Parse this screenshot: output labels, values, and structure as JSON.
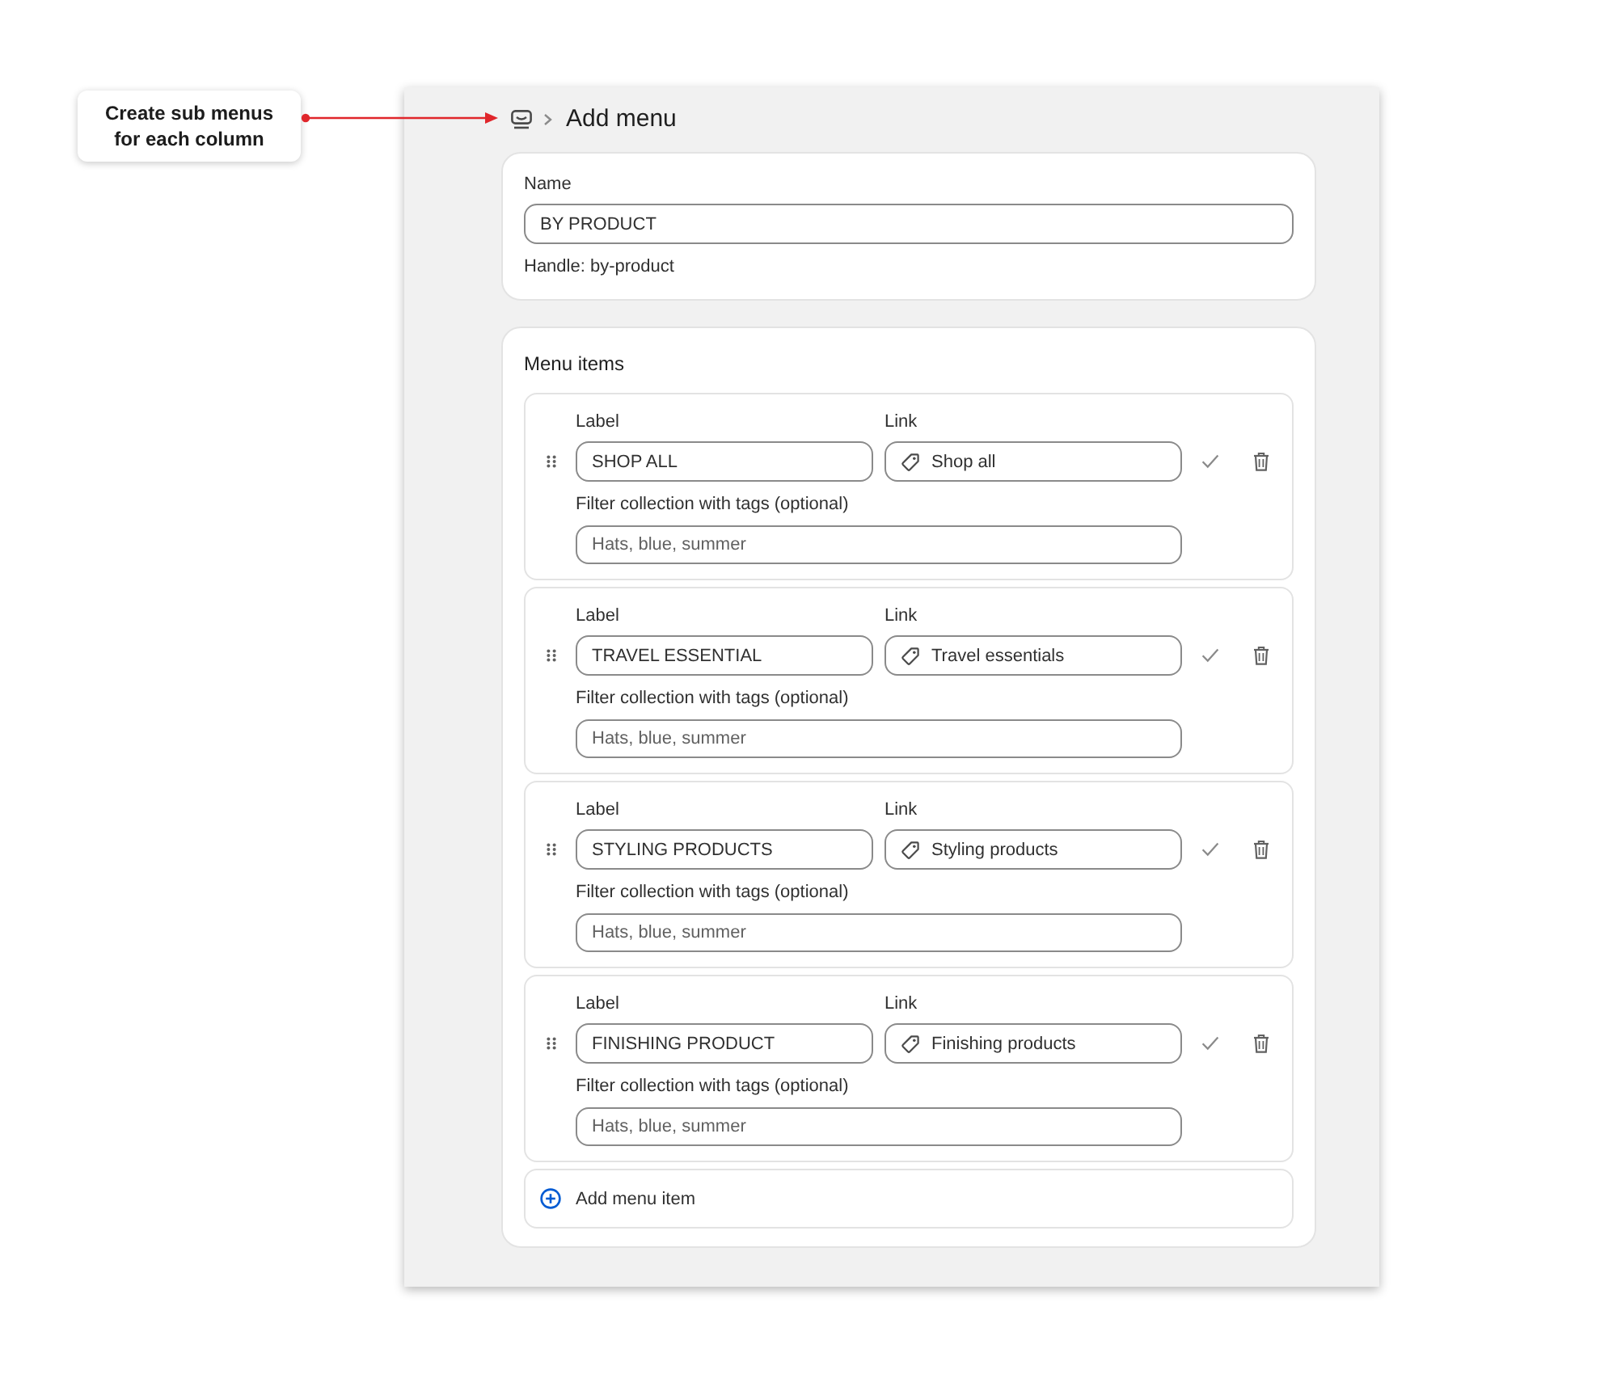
{
  "annotation": {
    "text": "Create sub menus for each column"
  },
  "header": {
    "title": "Add menu"
  },
  "name_card": {
    "label": "Name",
    "value": "BY PRODUCT",
    "handle": "Handle: by-product"
  },
  "menu_items": {
    "title": "Menu items",
    "items": [
      {
        "label_heading": "Label",
        "label_value": "SHOP ALL",
        "link_heading": "Link",
        "link_value": "Shop all",
        "filter_heading": "Filter collection with tags (optional)",
        "filter_placeholder": "Hats, blue, summer"
      },
      {
        "label_heading": "Label",
        "label_value": "TRAVEL ESSENTIAL",
        "link_heading": "Link",
        "link_value": "Travel essentials",
        "filter_heading": "Filter collection with tags (optional)",
        "filter_placeholder": "Hats, blue, summer"
      },
      {
        "label_heading": "Label",
        "label_value": "STYLING PRODUCTS",
        "link_heading": "Link",
        "link_value": "Styling products",
        "filter_heading": "Filter collection with tags (optional)",
        "filter_placeholder": "Hats, blue, summer"
      },
      {
        "label_heading": "Label",
        "label_value": "FINISHING PRODUCT",
        "link_heading": "Link",
        "link_value": "Finishing products",
        "filter_heading": "Filter collection with tags (optional)",
        "filter_placeholder": "Hats, blue, summer"
      }
    ],
    "add_button": "Add menu item"
  }
}
